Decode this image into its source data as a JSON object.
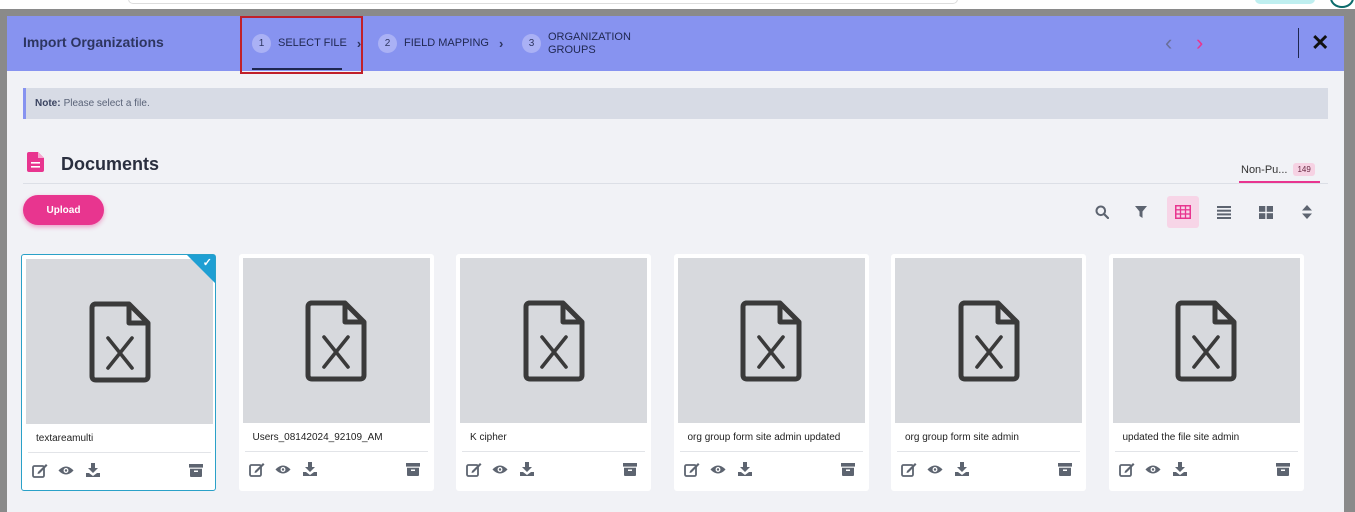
{
  "modal": {
    "title": "Import Organizations",
    "steps": [
      {
        "num": "1",
        "label": "SELECT FILE"
      },
      {
        "num": "2",
        "label": "FIELD MAPPING"
      },
      {
        "num": "3",
        "label": "ORGANIZATION GROUPS"
      }
    ],
    "nav_prev": "‹",
    "nav_next": "›",
    "close": "✕"
  },
  "note": {
    "label": "Note:",
    "text": "Please select a file."
  },
  "documents": {
    "title": "Documents",
    "tab_label": "Non-Pu...",
    "tab_count": "149",
    "upload_label": "Upload",
    "selected_index": 0,
    "cards": [
      {
        "name": "textareamulti"
      },
      {
        "name": "Users_08142024_92109_AM"
      },
      {
        "name": "K cipher"
      },
      {
        "name": "org group form site admin updated"
      },
      {
        "name": "org group form site admin"
      },
      {
        "name": "updated the file site admin"
      }
    ]
  },
  "colors": {
    "header": "#8793f0",
    "accent": "#e8358f",
    "selected_border": "#2aa1c8",
    "highlight": "#c0202a"
  },
  "icons": [
    "file-text-icon",
    "search-icon",
    "filter-icon",
    "grid-table-icon",
    "list-icon",
    "tiles-icon",
    "sort-icon",
    "excel-file-icon",
    "edit-icon",
    "eye-icon",
    "download-icon",
    "archive-icon",
    "check-icon"
  ]
}
